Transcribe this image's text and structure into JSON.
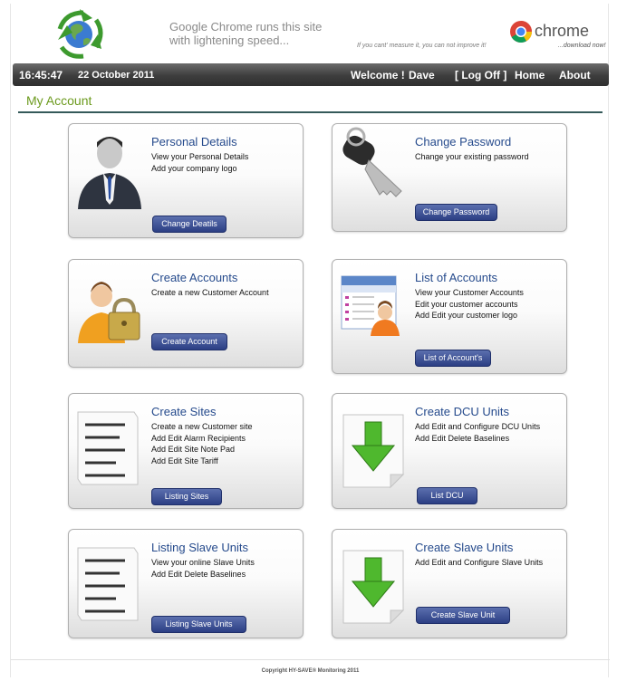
{
  "header": {
    "tagline_line1": "Google Chrome runs this site",
    "tagline_line2": "with lightening speed...",
    "motto": "If you cant' measure it, you can not improve it!",
    "chrome_word": "chrome",
    "chrome_download": "...download now!"
  },
  "navbar": {
    "clock": "16:45:47",
    "date": "22 October 2011",
    "welcome": "Welcome !",
    "user": "Dave",
    "logoff": "[ Log Off ]",
    "home": "Home",
    "about": "About"
  },
  "section_title": "My Account",
  "cards": [
    {
      "title": "Personal Details",
      "lines": [
        "View your Personal Details",
        "Add your company logo"
      ],
      "button": "Change Deatils"
    },
    {
      "title": "Change Password",
      "lines": [
        "Change your existing password"
      ],
      "button": "Change Password"
    },
    {
      "title": "Create Accounts",
      "lines": [
        "Create a new Customer Account"
      ],
      "button": "Create Account"
    },
    {
      "title": "List of Accounts",
      "lines": [
        "View your Customer Accounts",
        "Edit your customer accounts",
        "Add Edit your customer logo"
      ],
      "button": "List of Account's"
    },
    {
      "title": "Create Sites",
      "lines": [
        "Create a new Customer site",
        "Add Edit Alarm Recipients",
        "Add Edit Site Note Pad",
        "Add Edit Site Tariff"
      ],
      "button": "Listing Sites"
    },
    {
      "title": "Create DCU Units",
      "lines": [
        "Add Edit and Configure DCU Units",
        "Add Edit Delete Baselines"
      ],
      "button": "List DCU"
    },
    {
      "title": "Listing Slave Units",
      "lines": [
        "View your online Slave Units",
        "Add Edit Delete Baselines"
      ],
      "button": "Listing Slave Units"
    },
    {
      "title": "Create Slave Units",
      "lines": [
        "Add Edit and Configure Slave Units"
      ],
      "button": "Create Slave Unit"
    }
  ],
  "footer": "Copyright HY-SAVE® Monitoring 2011",
  "colors": {
    "accent_green": "#6c9a1e",
    "title_blue": "#254a8c",
    "button_blue": "#2c3f84"
  }
}
